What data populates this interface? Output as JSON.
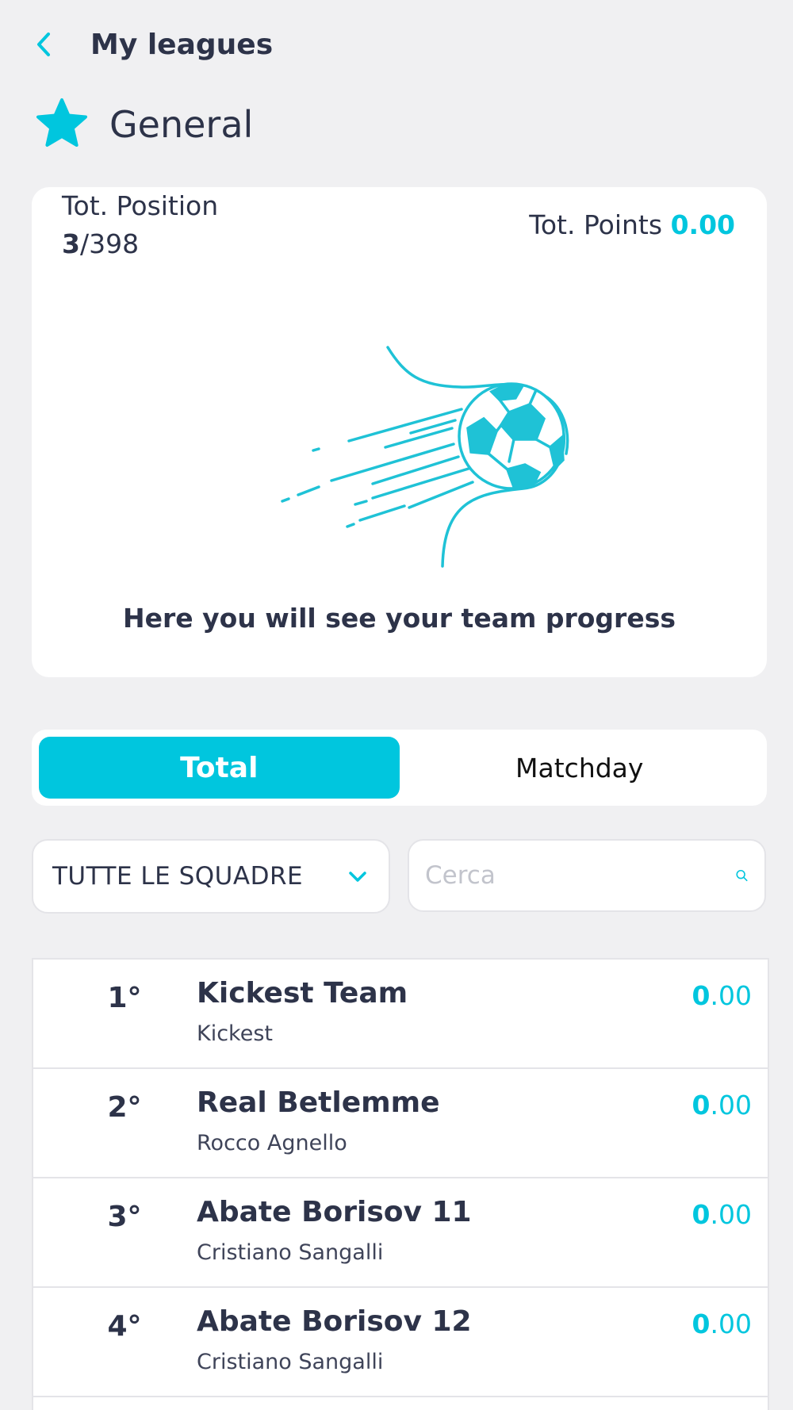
{
  "header": {
    "back_label": "My leagues"
  },
  "league": {
    "name": "General",
    "icon": "star-icon"
  },
  "summary": {
    "position_label": "Tot. Position",
    "position_rank": "3",
    "position_total": "/398",
    "points_label": "Tot. Points",
    "points_value": "0.00",
    "empty_message": "Here you will see your team progress"
  },
  "tabs": [
    {
      "label": "Total",
      "active": true
    },
    {
      "label": "Matchday",
      "active": false
    }
  ],
  "filter": {
    "selected": "TUTTE LE SQUADRE"
  },
  "search": {
    "placeholder": "Cerca",
    "value": ""
  },
  "ranking": [
    {
      "position": "1°",
      "team": "Kickest Team",
      "manager": "Kickest",
      "points_int": "0",
      "points_dec": ".00"
    },
    {
      "position": "2°",
      "team": "Real Betlemme",
      "manager": "Rocco Agnello",
      "points_int": "0",
      "points_dec": ".00"
    },
    {
      "position": "3°",
      "team": "Abate Borisov 11",
      "manager": "Cristiano Sangalli",
      "points_int": "0",
      "points_dec": ".00"
    },
    {
      "position": "4°",
      "team": "Abate Borisov 12",
      "manager": "Cristiano Sangalli",
      "points_int": "0",
      "points_dec": ".00"
    }
  ],
  "colors": {
    "accent": "#00c6de",
    "text": "#2d3349",
    "background": "#f0f0f2"
  }
}
